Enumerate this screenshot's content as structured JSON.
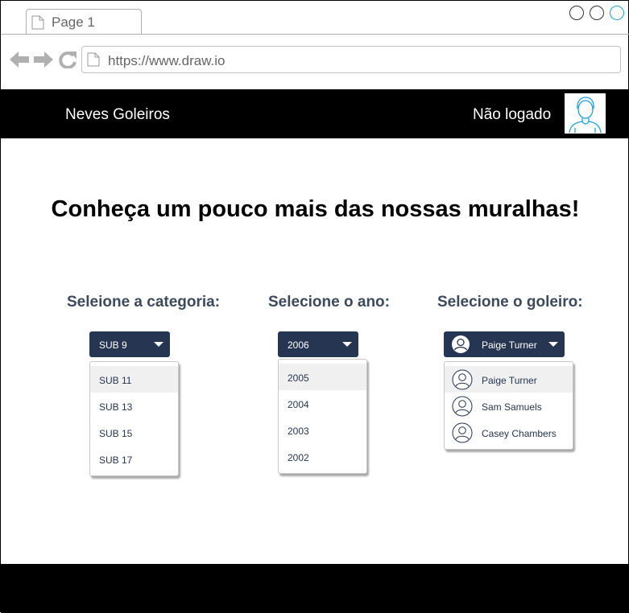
{
  "browser": {
    "tab_label": "Page 1",
    "url": "https://www.draw.io"
  },
  "header": {
    "brand": "Neves Goleiros",
    "login_status": "Não logado"
  },
  "main": {
    "heading": "Conheça um pouco mais das nossas muralhas!",
    "category": {
      "label": "Seleione a categoria:",
      "selected": "SUB 9",
      "options": [
        "SUB 11",
        "SUB 13",
        "SUB 15",
        "SUB 17"
      ]
    },
    "year": {
      "label": "Selecione o ano:",
      "selected": "2006",
      "options": [
        "2005",
        "2004",
        "2003",
        "2002"
      ]
    },
    "goalkeeper": {
      "label": "Selecione o goleiro:",
      "selected": "Paige Turner",
      "options": [
        "Paige Turner",
        "Sam Samuels",
        "Casey Chambers"
      ]
    }
  },
  "colors": {
    "select_bg": "#263552",
    "label_text": "#3c4a5c",
    "header_bg": "#000000"
  }
}
